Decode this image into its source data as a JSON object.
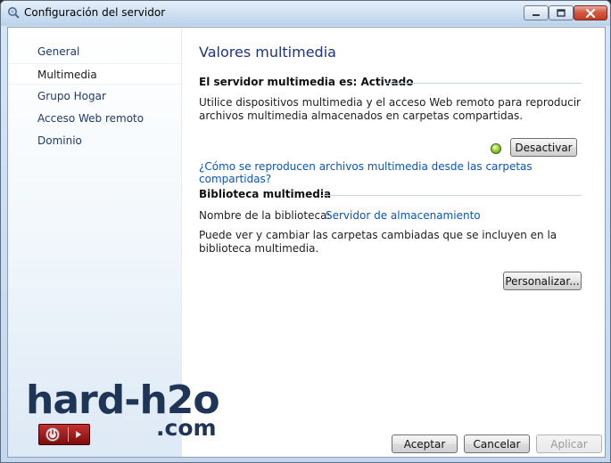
{
  "window": {
    "title": "Configuración del servidor",
    "icons": {
      "app": "gear-search-icon",
      "minimize": "minimize-icon",
      "maximize": "maximize-icon",
      "close": "close-icon"
    }
  },
  "sidebar": {
    "items": [
      {
        "label": "General",
        "selected": false
      },
      {
        "label": "Multimedia",
        "selected": true
      },
      {
        "label": "Grupo Hogar",
        "selected": false
      },
      {
        "label": "Acceso Web remoto",
        "selected": false
      },
      {
        "label": "Dominio",
        "selected": false
      }
    ]
  },
  "main": {
    "heading": "Valores multimedia",
    "server": {
      "status_title": "El servidor multimedia es: Activado",
      "description": "Utilice dispositivos multimedia y el acceso Web remoto para reproducir archivos multimedia almacenados en carpetas compartidas.",
      "status_color": "#7cc11f",
      "deactivate_label": "Desactivar",
      "help_link": "¿Cómo se reproducen archivos multimedia desde las carpetas compartidas?"
    },
    "library": {
      "section_title": "Biblioteca multimedia",
      "name_label": "Nombre de la biblioteca:",
      "name_value": "Servidor de almacenamiento",
      "description": "Puede ver y cambiar las carpetas cambiadas que se incluyen en la biblioteca multimedia.",
      "customize_label": "Personalizar..."
    }
  },
  "footer": {
    "accept_label": "Aceptar",
    "cancel_label": "Cancelar",
    "apply_label": "Aplicar",
    "apply_enabled": false
  },
  "watermark": {
    "line1": "hard-h2o",
    "line2": ".com",
    "badge_icons": [
      "power-icon",
      "play-icon"
    ],
    "color": "#1f3558"
  },
  "colors": {
    "link": "#0a55b8",
    "heading": "#1e3287",
    "accent": "#c6d6e8"
  }
}
